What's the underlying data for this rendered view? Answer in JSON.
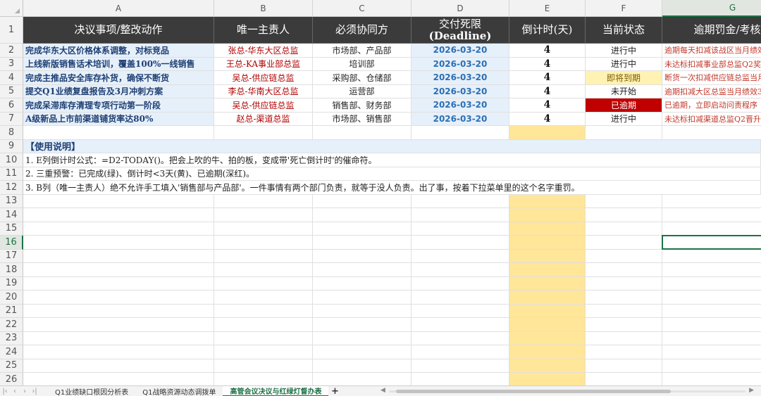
{
  "columns": [
    "A",
    "B",
    "C",
    "D",
    "E",
    "F",
    "G"
  ],
  "active_column": "G",
  "active_row": "16",
  "rows": [
    "1",
    "2",
    "3",
    "4",
    "5",
    "6",
    "7",
    "8",
    "9",
    "10",
    "11",
    "12",
    "13",
    "14",
    "15",
    "16",
    "17",
    "18",
    "19",
    "20",
    "21",
    "22",
    "23",
    "24",
    "25",
    "26"
  ],
  "header": {
    "task": "决议事项/整改动作",
    "owner": "唯一主责人",
    "collab": "必须协同方",
    "deadline_line1": "交付死限",
    "deadline_line2": "(Deadline)",
    "countdown": "倒计时(天)",
    "status": "当前状态",
    "penalty": "逾期罚金/考核扣"
  },
  "tasks": [
    {
      "task": "完成华东大区价格体系调整，对标竞品",
      "owner": "张总-华东大区总监",
      "collab": "市场部、产品部",
      "deadline": "2026-03-20",
      "countdown": "4",
      "status": "进行中",
      "status_type": "normal",
      "penalty": "逾期每天扣减该战区当月绩效"
    },
    {
      "task": "上线新版销售话术培训，覆盖100%一线销售",
      "owner": "王总-KA事业部总监",
      "collab": "培训部",
      "deadline": "2026-03-20",
      "countdown": "4",
      "status": "进行中",
      "status_type": "normal",
      "penalty": "未达标扣减事业部总监Q2奖金"
    },
    {
      "task": "完成主推品安全库存补货，确保不断货",
      "owner": "吴总-供应链总监",
      "collab": "采购部、仓储部",
      "deadline": "2026-03-20",
      "countdown": "4",
      "status": "即将到期",
      "status_type": "warn",
      "penalty": "断货一次扣减供应链总监当月"
    },
    {
      "task": "提交Q1业绩复盘报告及3月冲刺方案",
      "owner": "李总-华南大区总监",
      "collab": "运营部",
      "deadline": "2026-03-20",
      "countdown": "4",
      "status": "未开始",
      "status_type": "normal",
      "penalty": "逾期扣减大区总监当月绩效3"
    },
    {
      "task": "完成呆滞库存清理专项行动第一阶段",
      "owner": "吴总-供应链总监",
      "collab": "销售部、财务部",
      "deadline": "2026-03-20",
      "countdown": "4",
      "status": "已逾期",
      "status_type": "over",
      "penalty": "已逾期，立即启动问责程序"
    },
    {
      "task": "A级新品上市前渠道铺货率达80%",
      "owner": "赵总-渠道总监",
      "collab": "市场部、销售部",
      "deadline": "2026-03-20",
      "countdown": "4",
      "status": "进行中",
      "status_type": "normal",
      "penalty": "未达标扣减渠道总监Q2晋升"
    }
  ],
  "notes": {
    "title": "【使用说明】",
    "line1": "1. E列倒计时公式：=D2-TODAY()。把会上吹的牛、拍的板，变成带'死亡倒计时'的催命符。",
    "line2": "2. 三重预警：已完成(绿)、倒计时<3天(黄)、已逾期(深红)。",
    "line3": "3. B列（唯一主责人）绝不允许手工填入'销售部与产品部'。一件事情有两个部门负责，就等于没人负责。出了事，按着下拉菜单里的这个名字重罚。"
  },
  "sheet_tabs": [
    {
      "label": "Q1业绩缺口根因分析表",
      "active": false
    },
    {
      "label": "Q1战略资源动态调拨单",
      "active": false
    },
    {
      "label": "高管会议决议与红绿灯督办表",
      "active": true
    }
  ],
  "nav_icons": [
    "first-sheet-icon",
    "prev-sheet-icon",
    "next-sheet-icon",
    "last-sheet-icon"
  ],
  "colors": {
    "header_bg": "#3b3b3b",
    "accent": "#1e7145",
    "warn": "#fff2b2",
    "overdue": "#c00000",
    "highlight_col": "#ffe699"
  }
}
